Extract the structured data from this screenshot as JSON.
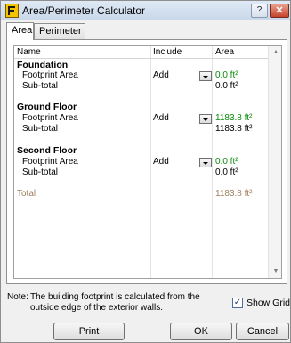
{
  "window": {
    "title": "Area/Perimeter Calculator",
    "help_label": "?",
    "close_label": "✕"
  },
  "tabs": [
    {
      "label": "Area"
    },
    {
      "label": "Perimeter"
    }
  ],
  "grid": {
    "columns": [
      "Name",
      "Include",
      "Area"
    ],
    "sections": [
      {
        "title": "Foundation",
        "footprint": {
          "name": "Footprint Area",
          "include": "Add",
          "area": "0.0 ft²"
        },
        "subtotal": {
          "name": "Sub-total",
          "area": "0.0 ft²"
        }
      },
      {
        "title": "Ground Floor",
        "footprint": {
          "name": "Footprint Area",
          "include": "Add",
          "area": "1183.8 ft²"
        },
        "subtotal": {
          "name": "Sub-total",
          "area": "1183.8 ft²"
        }
      },
      {
        "title": "Second Floor",
        "footprint": {
          "name": "Footprint Area",
          "include": "Add",
          "area": "0.0 ft²"
        },
        "subtotal": {
          "name": "Sub-total",
          "area": "0.0 ft²"
        }
      }
    ],
    "total": {
      "name": "Total",
      "area": "1183.8 ft²"
    },
    "scroll_up": "▲",
    "scroll_down": "▼"
  },
  "note": {
    "label": "Note:",
    "text": "The building footprint is calculated from the outside edge of the exterior walls."
  },
  "show_grid": {
    "label": "Show Grid",
    "checked": true,
    "check_mark": "✓"
  },
  "buttons": {
    "print": "Print",
    "ok": "OK",
    "cancel": "Cancel"
  },
  "colors": {
    "area_value": "#0a8a0a",
    "total": "#a08060"
  }
}
